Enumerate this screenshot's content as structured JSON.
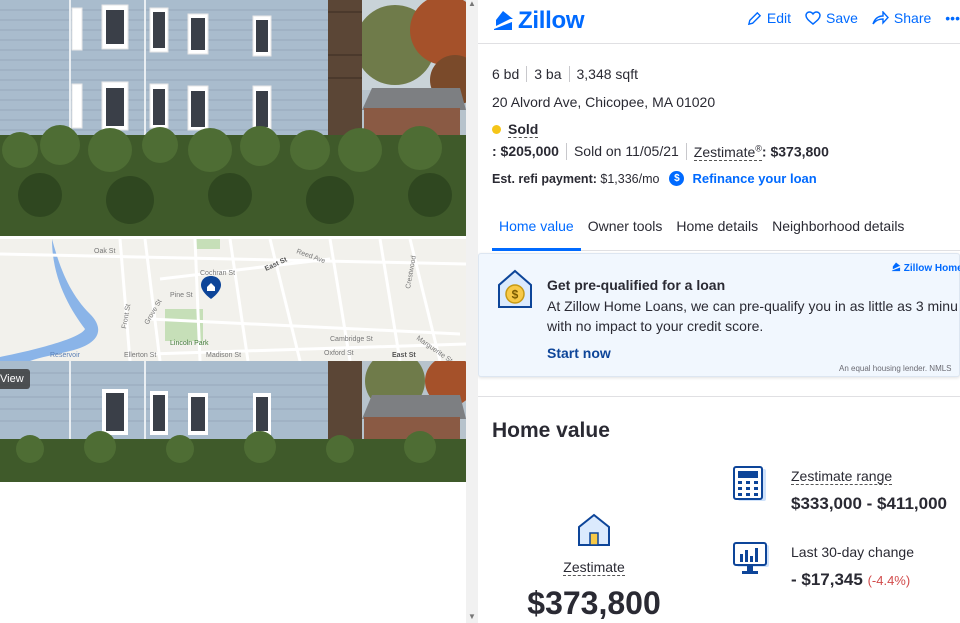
{
  "gallery": {
    "view_button_label": "View"
  },
  "map": {
    "streets": [
      "Oak St",
      "Cochran St",
      "Pine St",
      "Grove St",
      "Front St",
      "East St",
      "Reed Ave",
      "Crestwood",
      "Lincoln Park",
      "Madison St",
      "Ellerton St",
      "Cambridge St",
      "Oxford St",
      "East St",
      "Marguerite St",
      "Parkwood Dr",
      "Boys Cir",
      "High St",
      "Southwick St",
      "Walton St",
      "Stelton St",
      "Jean Cir",
      "Wildermere"
    ],
    "park_label": "Lincoln Park",
    "reservoir_label": "Reservoir"
  },
  "header": {
    "logo_text": "Zillow",
    "actions": {
      "edit": "Edit",
      "save": "Save",
      "share": "Share",
      "more": "•••"
    }
  },
  "summary": {
    "beds": "6 bd",
    "baths": "3 ba",
    "sqft": "3,348 sqft",
    "address": "20 Alvord Ave, Chicopee, MA 01020",
    "status": "Sold",
    "status_color": "#f5c518",
    "sold_price": ": $205,000",
    "sold_date": "Sold on 11/05/21",
    "zestimate_label": "Zestimate",
    "zestimate_reg": "®",
    "zestimate_value": ": $373,800",
    "refi_label": "Est. refi payment:",
    "refi_value": "$1,336/mo",
    "refi_badge": "$",
    "refi_link": "Refinance your loan"
  },
  "tabs": [
    "Home value",
    "Owner tools",
    "Home details",
    "Neighborhood details"
  ],
  "promo": {
    "title": "Get pre-qualified for a loan",
    "body_line1": "At Zillow Home Loans, we can pre-qualify you in as little as 3 minu",
    "body_line2": "with no impact to your credit score.",
    "cta": "Start now",
    "brand": "Zillow Home",
    "disclaimer": "An equal housing lender. NMLS"
  },
  "home_value": {
    "title": "Home value",
    "zestimate_label": "Zestimate",
    "zestimate_value": "$373,800",
    "range_label": "Zestimate range",
    "range_value": "$333,000 - $411,000",
    "change_label": "Last 30-day change",
    "change_value": "- $17,345",
    "change_pct": "(-4.4%)"
  },
  "colors": {
    "brand": "#006aff",
    "negative": "#d24b4b"
  }
}
